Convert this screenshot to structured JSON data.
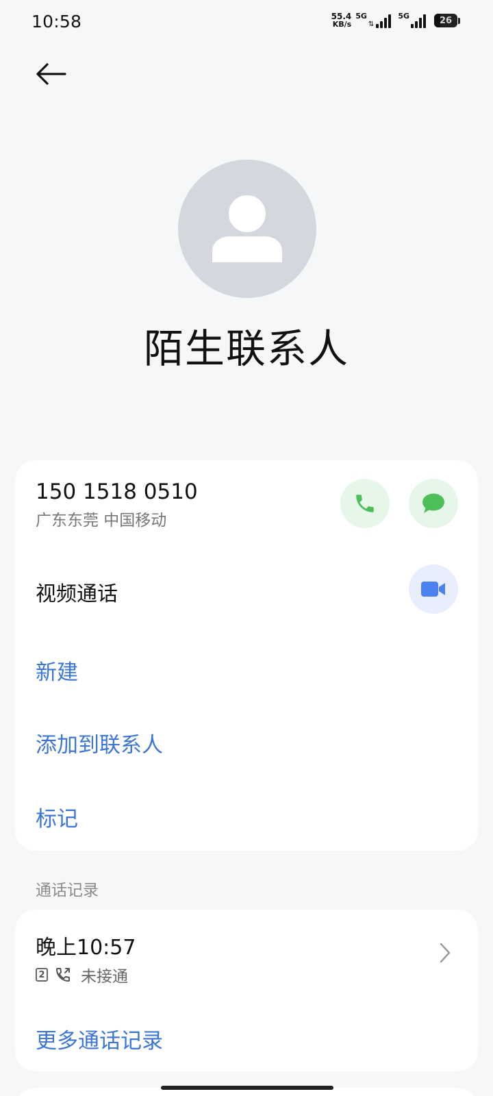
{
  "status_bar": {
    "time": "10:58",
    "net_speed_value": "55.4",
    "net_speed_unit": "KB/s",
    "sim1_label": "5G",
    "sim2_label": "5G",
    "battery_level": "26"
  },
  "header": {
    "back_icon": "arrow-left-icon"
  },
  "contact": {
    "avatar_icon": "person-icon",
    "name": "陌生联系人",
    "phone_number": "150 1518 0510",
    "location": "广东东莞 中国移动"
  },
  "actions": {
    "video_call_label": "视频通话",
    "new_label": "新建",
    "add_to_contacts_label": "添加到联系人",
    "mark_label": "标记"
  },
  "call_log": {
    "section_title": "通话记录",
    "entries": [
      {
        "time": "晚上10:57",
        "sim": "2",
        "status": "未接通"
      }
    ],
    "more_label": "更多通话记录"
  },
  "colors": {
    "accent": "#3b76d7",
    "call_green": "#4cbf5b",
    "call_bg": "#e6f6e9",
    "video_blue": "#4c82f0",
    "video_bg": "#e9eefc",
    "avatar_bg": "#d4d8de"
  }
}
